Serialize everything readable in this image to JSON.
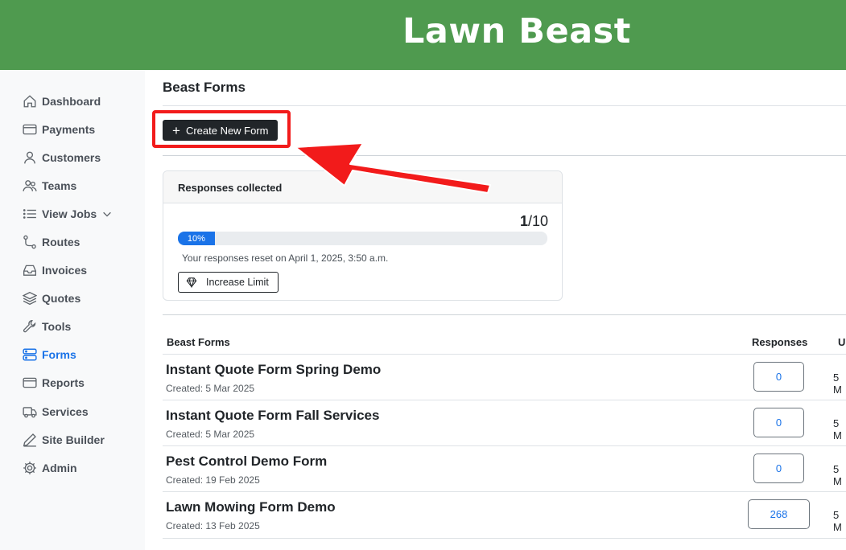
{
  "app": {
    "brand": "Lawn Beast"
  },
  "sidebar": {
    "items": [
      {
        "label": "Dashboard",
        "icon": "home-icon"
      },
      {
        "label": "Payments",
        "icon": "credit-card-icon"
      },
      {
        "label": "Customers",
        "icon": "person-icon"
      },
      {
        "label": "Teams",
        "icon": "people-icon"
      },
      {
        "label": "View Jobs",
        "icon": "list-icon"
      },
      {
        "label": "Routes",
        "icon": "route-icon"
      },
      {
        "label": "Invoices",
        "icon": "inbox-icon"
      },
      {
        "label": "Quotes",
        "icon": "layers-icon"
      },
      {
        "label": "Tools",
        "icon": "wrench-icon"
      },
      {
        "label": "Forms",
        "icon": "server-icon"
      },
      {
        "label": "Reports",
        "icon": "card-icon"
      },
      {
        "label": "Services",
        "icon": "truck-icon"
      },
      {
        "label": "Site Builder",
        "icon": "pencil-icon"
      },
      {
        "label": "Admin",
        "icon": "gear-icon"
      }
    ],
    "active": "Forms",
    "active_color": "#1a73e8"
  },
  "main": {
    "page_title": "Beast Forms",
    "create_button_label": "Create New Form",
    "responses_card": {
      "title": "Responses collected",
      "used": "1",
      "limit": "/10",
      "progress_label": "10%",
      "progress_percent": 10,
      "reset_text": "Your responses reset on April 1, 2025, 3:50 a.m.",
      "increase_button_label": "Increase Limit"
    },
    "table": {
      "headers": {
        "name": "Beast Forms",
        "responses": "Responses",
        "updated": "U"
      },
      "rows": [
        {
          "title": "Instant Quote Form Spring Demo",
          "created": "Created: 5 Mar 2025",
          "responses": "0",
          "updated": "5 M"
        },
        {
          "title": "Instant Quote Form Fall Services",
          "created": "Created: 5 Mar 2025",
          "responses": "0",
          "updated": "5 M"
        },
        {
          "title": "Pest Control Demo Form",
          "created": "Created: 19 Feb 2025",
          "responses": "0",
          "updated": "5 M"
        },
        {
          "title": "Lawn Mowing Form Demo",
          "created": "Created: 13 Feb 2025",
          "responses": "268",
          "updated": "5 M"
        }
      ]
    }
  },
  "colors": {
    "header_green": "#4f9a4f",
    "annotation_red": "#f21b1b",
    "link_blue": "#1a73e8"
  }
}
